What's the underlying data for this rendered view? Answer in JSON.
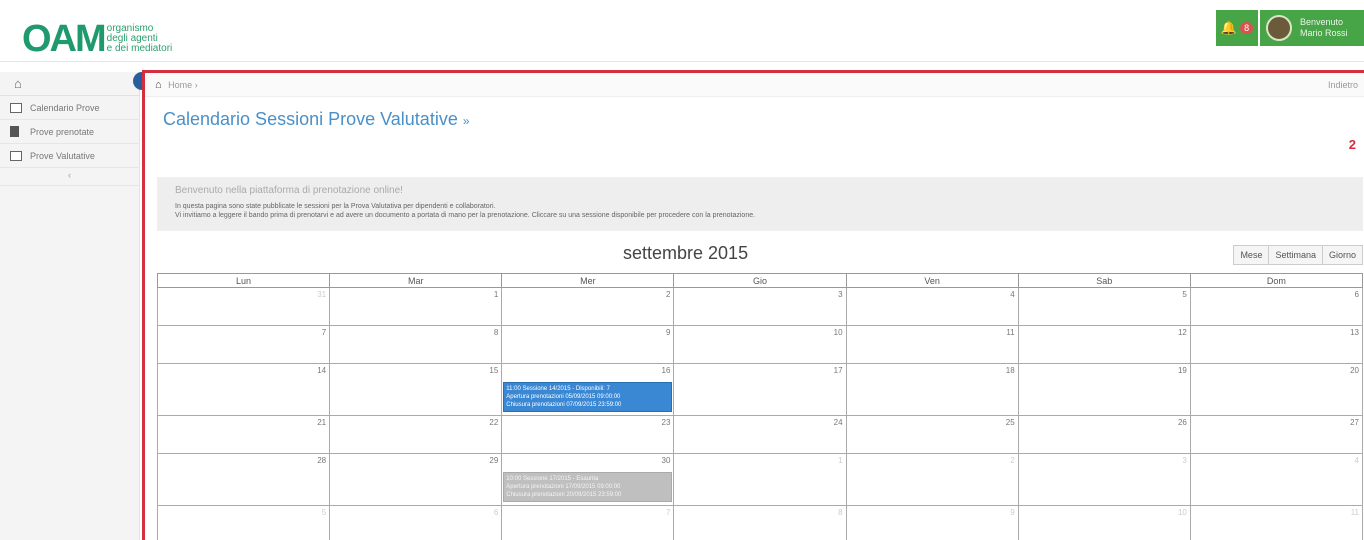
{
  "header": {
    "logo_mark": "OAM",
    "logo_lines": [
      "organismo",
      "degli agenti",
      "e dei mediatori"
    ],
    "notifications_count": "8",
    "user_greeting": "Benvenuto",
    "user_name": "Mario Rossi",
    "accent_color": "#47a447"
  },
  "sidebar": {
    "items": [
      {
        "label": "Calendario Prove",
        "icon": "calendar-icon"
      },
      {
        "label": "Prove prenotate",
        "icon": "document-icon"
      },
      {
        "label": "Prove Valutative",
        "icon": "calendar-icon"
      }
    ]
  },
  "breadcrumb": {
    "home": "Home",
    "right_text": "Indietro"
  },
  "page": {
    "title": "Calendario Sessioni Prove Valutative",
    "title_suffix": "»",
    "badge": "2"
  },
  "alert": {
    "title": "Benvenuto nella piattaforma di prenotazione online!",
    "line1": "In questa pagina sono state pubblicate le sessioni per la Prova Valutativa per dipendenti e collaboratori.",
    "line2": "Vi invitiamo a leggere il bando prima di prenotarvi e ad avere un documento a portata di mano per la prenotazione. Cliccare su una sessione disponibile per procedere con la prenotazione."
  },
  "calendar": {
    "month": "settembre 2015",
    "views": [
      "Mese",
      "Settimana",
      "Giorno"
    ],
    "weekdays": [
      "Lun",
      "Mar",
      "Mer",
      "Gio",
      "Ven",
      "Sab",
      "Dom"
    ],
    "weeks": [
      [
        "31",
        "1",
        "2",
        "3",
        "4",
        "5",
        "6"
      ],
      [
        "7",
        "8",
        "9",
        "10",
        "11",
        "12",
        "13"
      ],
      [
        "14",
        "15",
        "16",
        "17",
        "18",
        "19",
        "20"
      ],
      [
        "21",
        "22",
        "23",
        "24",
        "25",
        "26",
        "27"
      ],
      [
        "28",
        "29",
        "30",
        "1",
        "2",
        "3",
        "4"
      ],
      [
        "5",
        "6",
        "7",
        "8",
        "9",
        "10",
        "11"
      ]
    ],
    "events": {
      "blue": {
        "line1": "11:00 Sessione 14/2015 - Disponibili: 7",
        "line2": "Apertura prenotazioni 05/09/2015 09:00:00",
        "line3": "Chiusura prenotazioni 07/09/2015 23:59:00"
      },
      "grey": {
        "line1": "10:00 Sessione 17/2015 - Esaurita",
        "line2": "Apertura prenotazioni 17/09/2015 09:00:00",
        "line3": "Chiusura prenotazioni 20/09/2015 23:59:00"
      }
    }
  }
}
